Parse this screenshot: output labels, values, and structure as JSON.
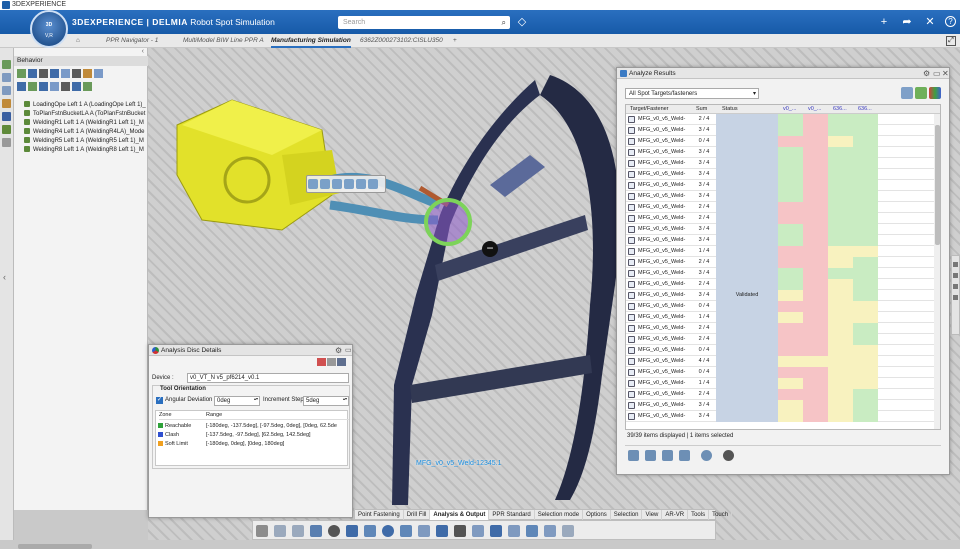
{
  "window": {
    "title": "3DEXPERIENCE"
  },
  "app": {
    "brand": "3DEXPERIENCE | DELMIA",
    "product": "Robot Spot Simulation",
    "compass_top": "3D",
    "compass_bottom": "V,R"
  },
  "search": {
    "placeholder": "Search"
  },
  "tabs": [
    {
      "label": "PPR Navigator - 1"
    },
    {
      "label": "MultiModel BIW Line PPR A"
    },
    {
      "label": "Manufacturing Simulation"
    },
    {
      "label": "6362Z000273102:CISLU350"
    },
    {
      "label": "+"
    }
  ],
  "tree": {
    "header": "Behavior",
    "items": [
      "LoadingOpe Left 1 A (LoadingOpe Left 1)_",
      "ToPlanFstnBucketLA A (ToPlanFstnBucket",
      "WeldingR1 Left 1 A (WeldingR1 Left 1)_M",
      "WeldingR4 Left 1 A (WeldingR4LA)_Mode",
      "WeldingR5 Left 1 A (WeldingR5 Left 1)_M",
      "WeldingR8 Left 1 A (WeldingR8 Left 1)_M"
    ]
  },
  "viewport": {
    "point_label": "MFG_v0_v5_Weld-12345.1"
  },
  "analyze_results": {
    "title": "Analyze Results",
    "filter": "All Spot Targets/fasteners",
    "columns": [
      "Target/Fastener",
      "Sum",
      "Status",
      "v0_...",
      "v0_...",
      "636...",
      "636..."
    ],
    "rows": [
      {
        "name": "MFG_v0_v5_Weld-",
        "sum": "2 / 4",
        "status": "",
        "cells": [
          "g",
          "p",
          "g",
          "g"
        ]
      },
      {
        "name": "MFG_v0_v5_Weld-",
        "sum": "3 / 4",
        "status": "",
        "cells": [
          "g",
          "p",
          "g",
          "g"
        ]
      },
      {
        "name": "MFG_v0_v5_Weld-",
        "sum": "0 / 4",
        "status": "",
        "cells": [
          "p",
          "p",
          "y",
          "g"
        ]
      },
      {
        "name": "MFG_v0_v5_Weld-",
        "sum": "3 / 4",
        "status": "",
        "cells": [
          "g",
          "p",
          "g",
          "g"
        ]
      },
      {
        "name": "MFG_v0_v5_Weld-",
        "sum": "3 / 4",
        "status": "",
        "cells": [
          "g",
          "p",
          "g",
          "g"
        ]
      },
      {
        "name": "MFG_v0_v5_Weld-",
        "sum": "3 / 4",
        "status": "",
        "cells": [
          "g",
          "p",
          "g",
          "g"
        ]
      },
      {
        "name": "MFG_v0_v5_Weld-",
        "sum": "3 / 4",
        "status": "",
        "cells": [
          "g",
          "p",
          "g",
          "g"
        ]
      },
      {
        "name": "MFG_v0_v5_Weld-",
        "sum": "3 / 4",
        "status": "",
        "cells": [
          "g",
          "p",
          "g",
          "g"
        ]
      },
      {
        "name": "MFG_v0_v5_Weld-",
        "sum": "2 / 4",
        "status": "",
        "cells": [
          "p",
          "p",
          "g",
          "g"
        ]
      },
      {
        "name": "MFG_v0_v5_Weld-",
        "sum": "2 / 4",
        "status": "",
        "cells": [
          "p",
          "p",
          "g",
          "g"
        ]
      },
      {
        "name": "MFG_v0_v5_Weld-",
        "sum": "3 / 4",
        "status": "",
        "cells": [
          "g",
          "p",
          "g",
          "g"
        ]
      },
      {
        "name": "MFG_v0_v5_Weld-",
        "sum": "3 / 4",
        "status": "",
        "cells": [
          "g",
          "p",
          "g",
          "g"
        ]
      },
      {
        "name": "MFG_v0_v5_Weld-",
        "sum": "1 / 4",
        "status": "",
        "cells": [
          "p",
          "p",
          "y",
          "y"
        ]
      },
      {
        "name": "MFG_v0_v5_Weld-",
        "sum": "2 / 4",
        "status": "",
        "cells": [
          "p",
          "p",
          "y",
          "g"
        ]
      },
      {
        "name": "MFG_v0_v5_Weld-",
        "sum": "3 / 4",
        "status": "",
        "cells": [
          "g",
          "p",
          "g",
          "g"
        ]
      },
      {
        "name": "MFG_v0_v5_Weld-",
        "sum": "2 / 4",
        "status": "",
        "cells": [
          "g",
          "p",
          "y",
          "g"
        ]
      },
      {
        "name": "MFG_v0_v5_Weld-",
        "sum": "3 / 4",
        "status": "Validated",
        "cells": [
          "y",
          "p",
          "y",
          "g"
        ]
      },
      {
        "name": "MFG_v0_v5_Weld-",
        "sum": "0 / 4",
        "status": "",
        "cells": [
          "p",
          "p",
          "y",
          "y"
        ]
      },
      {
        "name": "MFG_v0_v5_Weld-",
        "sum": "1 / 4",
        "status": "",
        "cells": [
          "y",
          "p",
          "y",
          "y"
        ]
      },
      {
        "name": "MFG_v0_v5_Weld-",
        "sum": "2 / 4",
        "status": "",
        "cells": [
          "p",
          "p",
          "y",
          "g"
        ]
      },
      {
        "name": "MFG_v0_v5_Weld-",
        "sum": "2 / 4",
        "status": "",
        "cells": [
          "p",
          "p",
          "y",
          "g"
        ]
      },
      {
        "name": "MFG_v0_v5_Weld-",
        "sum": "0 / 4",
        "status": "",
        "cells": [
          "p",
          "p",
          "y",
          "y"
        ]
      },
      {
        "name": "MFG_v0_v5_Weld-",
        "sum": "4 / 4",
        "status": "",
        "cells": [
          "y",
          "y",
          "y",
          "y"
        ]
      },
      {
        "name": "MFG_v0_v5_Weld-",
        "sum": "0 / 4",
        "status": "",
        "cells": [
          "p",
          "p",
          "y",
          "y"
        ]
      },
      {
        "name": "MFG_v0_v5_Weld-",
        "sum": "1 / 4",
        "status": "",
        "cells": [
          "y",
          "p",
          "y",
          "y"
        ]
      },
      {
        "name": "MFG_v0_v5_Weld-",
        "sum": "2 / 4",
        "status": "",
        "cells": [
          "p",
          "p",
          "y",
          "g"
        ]
      },
      {
        "name": "MFG_v0_v5_Weld-",
        "sum": "3 / 4",
        "status": "",
        "cells": [
          "y",
          "p",
          "y",
          "g"
        ]
      },
      {
        "name": "MFG_v0_v5_Weld-",
        "sum": "3 / 4",
        "status": "",
        "cells": [
          "y",
          "p",
          "y",
          "g"
        ]
      }
    ],
    "status_text": "39/39 items displayed | 1 items selected"
  },
  "analysis_disc": {
    "title": "Analysis Disc Details",
    "device_label": "Device :",
    "device_value": "v0_VT_N v5_pf6214_v0.1",
    "section": "Tool Orientation",
    "angular_label": "Angular Deviation",
    "angular_value": "0deg",
    "increment_label": "Increment Step",
    "increment_value": "5deg",
    "zone_header": "Zone",
    "range_header": "Range",
    "zones": [
      {
        "name": "Reachable",
        "range": "[-180deg, -137.5deg],   [-97.5deg, 0deg],   [0deg, 62.5de",
        "color": "#2ea23a"
      },
      {
        "name": "Clash",
        "range": "[-137.5deg, -97.5deg],   [62.5deg, 142.5deg]",
        "color": "#2f4fd0"
      },
      {
        "name": "Soft Limit",
        "range": "[-180deg, 0deg],   [0deg, 180deg]",
        "color": "#f0a020"
      }
    ]
  },
  "section_tabs": [
    "Point Fastening",
    "Drill Fill",
    "Analysis & Output",
    "PPR Standard",
    "Selection mode",
    "Options",
    "Selection",
    "View",
    "AR-VR",
    "Tools",
    "Touch"
  ],
  "colors": {
    "accent": "#2a6fbf",
    "green_cell": "#c9ecc2",
    "pink_cell": "#f6c4c6",
    "yellow_cell": "#f8f2bf"
  }
}
